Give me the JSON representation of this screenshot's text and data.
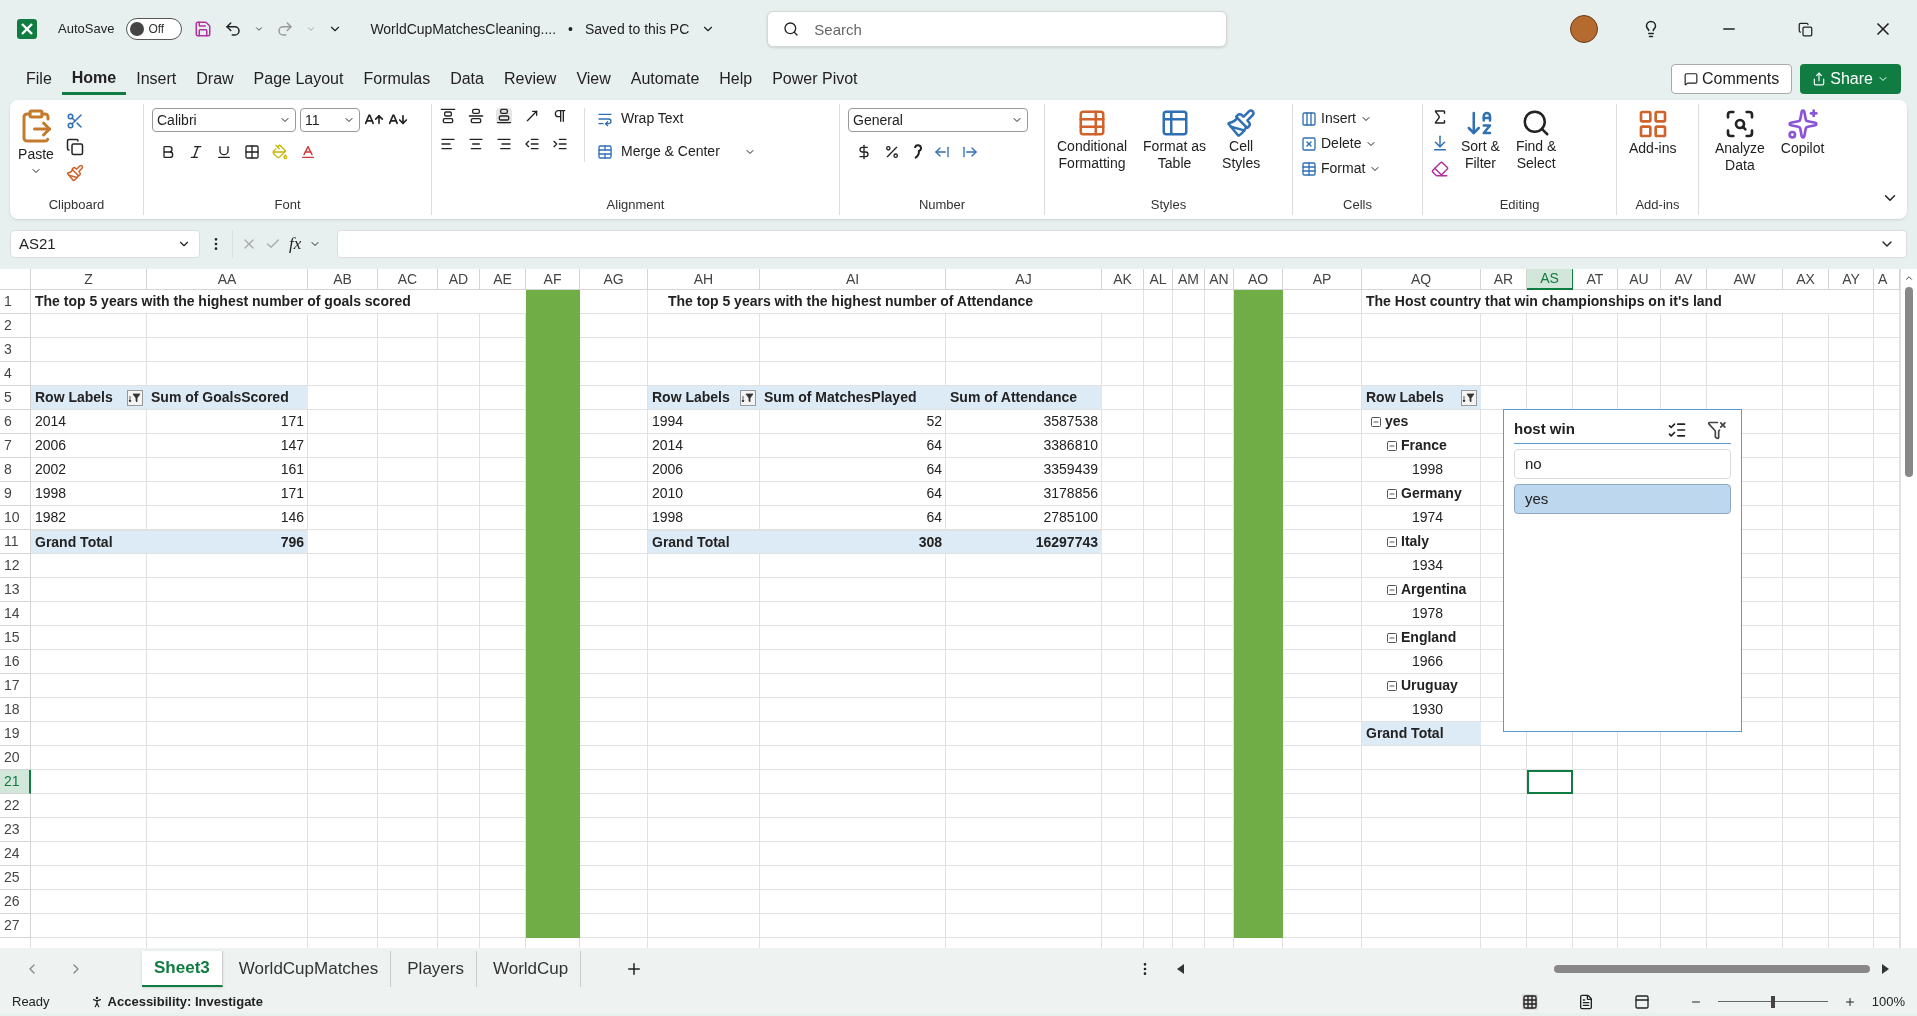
{
  "title_bar": {
    "autosave_label": "AutoSave",
    "autosave": {
      "on": false,
      "label": "Off"
    },
    "file_name": "WorldCupMatchesCleaning....",
    "separator": "•",
    "save_status": "Saved to this PC",
    "search": {
      "placeholder": "Search"
    }
  },
  "menu": {
    "tabs": [
      {
        "label": "File",
        "selected": false
      },
      {
        "label": "Home",
        "selected": true
      },
      {
        "label": "Insert",
        "selected": false
      },
      {
        "label": "Draw",
        "selected": false
      },
      {
        "label": "Page Layout",
        "selected": false
      },
      {
        "label": "Formulas",
        "selected": false
      },
      {
        "label": "Data",
        "selected": false
      },
      {
        "label": "Review",
        "selected": false
      },
      {
        "label": "View",
        "selected": false
      },
      {
        "label": "Automate",
        "selected": false
      },
      {
        "label": "Help",
        "selected": false
      },
      {
        "label": "Power Pivot",
        "selected": false
      }
    ],
    "comments": "Comments",
    "share": "Share"
  },
  "ribbon": {
    "clipboard": {
      "paste": "Paste",
      "label": "Clipboard"
    },
    "font": {
      "name": "Calibri",
      "size": "11",
      "label": "Font"
    },
    "alignment": {
      "wrap": "Wrap Text",
      "merge": "Merge & Center",
      "label": "Alignment"
    },
    "number": {
      "format": "General",
      "label": "Number"
    },
    "styles": {
      "buttons": [
        [
          "Conditional",
          "Formatting"
        ],
        [
          "Format as",
          "Table"
        ],
        [
          "Cell",
          "Styles"
        ]
      ],
      "label": "Styles"
    },
    "cells": {
      "buttons": [
        "Insert",
        "Delete",
        "Format"
      ],
      "label": "Cells"
    },
    "editing": {
      "buttons": [
        [
          "Sort &",
          "Filter"
        ],
        [
          "Find &",
          "Select"
        ]
      ],
      "label": "Editing"
    },
    "addins": {
      "button": "Add-ins",
      "label": "Add-ins"
    },
    "extras": [
      [
        "Analyze",
        "Data"
      ],
      [
        "Copilot"
      ]
    ]
  },
  "formula_bar": {
    "name_box": "AS21",
    "fx": "fx"
  },
  "column_headers": [
    {
      "label": "Z",
      "selected": false
    },
    {
      "label": "AA",
      "selected": false
    },
    {
      "label": "AB",
      "selected": false
    },
    {
      "label": "AC",
      "selected": false
    },
    {
      "label": "AD",
      "selected": false
    },
    {
      "label": "AE",
      "selected": false
    },
    {
      "label": "AF",
      "selected": false
    },
    {
      "label": "AG",
      "selected": false
    },
    {
      "label": "AH",
      "selected": false
    },
    {
      "label": "AI",
      "selected": false
    },
    {
      "label": "AJ",
      "selected": false
    },
    {
      "label": "AK",
      "selected": false
    },
    {
      "label": "AL",
      "selected": false
    },
    {
      "label": "AM",
      "selected": false
    },
    {
      "label": "AN",
      "selected": false
    },
    {
      "label": "AO",
      "selected": false
    },
    {
      "label": "AP",
      "selected": false
    },
    {
      "label": "AQ",
      "selected": false
    },
    {
      "label": "AR",
      "selected": false
    },
    {
      "label": "AS",
      "selected": true
    },
    {
      "label": "AT",
      "selected": false
    },
    {
      "label": "AU",
      "selected": false
    },
    {
      "label": "AV",
      "selected": false
    },
    {
      "label": "AW",
      "selected": false
    },
    {
      "label": "AX",
      "selected": false
    },
    {
      "label": "AY",
      "selected": false
    },
    {
      "label": "A",
      "selected": false
    }
  ],
  "row_headers": [
    {
      "label": "1",
      "selected": false
    },
    {
      "label": "2",
      "selected": false
    },
    {
      "label": "3",
      "selected": false
    },
    {
      "label": "4",
      "selected": false
    },
    {
      "label": "5",
      "selected": false
    },
    {
      "label": "6",
      "selected": false
    },
    {
      "label": "7",
      "selected": false
    },
    {
      "label": "8",
      "selected": false
    },
    {
      "label": "9",
      "selected": false
    },
    {
      "label": "10",
      "selected": false
    },
    {
      "label": "11",
      "selected": false
    },
    {
      "label": "12",
      "selected": false
    },
    {
      "label": "13",
      "selected": false
    },
    {
      "label": "14",
      "selected": false
    },
    {
      "label": "15",
      "selected": false
    },
    {
      "label": "16",
      "selected": false
    },
    {
      "label": "17",
      "selected": false
    },
    {
      "label": "18",
      "selected": false
    },
    {
      "label": "19",
      "selected": false
    },
    {
      "label": "20",
      "selected": false
    },
    {
      "label": "21",
      "selected": true
    },
    {
      "label": "22",
      "selected": false
    },
    {
      "label": "23",
      "selected": false
    },
    {
      "label": "24",
      "selected": false
    },
    {
      "label": "25",
      "selected": false
    },
    {
      "label": "26",
      "selected": false
    },
    {
      "label": "27",
      "selected": false
    }
  ],
  "titles": [
    "The top 5 years with the highest number of goals scored",
    "The top 5 years with the highest number of Attendance",
    "The Host country that win championships on it's land"
  ],
  "pivot_goals": {
    "header": [
      "Row Labels",
      "Sum of GoalsScored"
    ],
    "rows": [
      [
        "2014",
        "171"
      ],
      [
        "2006",
        "147"
      ],
      [
        "2002",
        "161"
      ],
      [
        "1998",
        "171"
      ],
      [
        "1982",
        "146"
      ]
    ],
    "total": [
      "Grand Total",
      "796"
    ]
  },
  "pivot_attendance": {
    "header": [
      "Row Labels",
      "Sum of MatchesPlayed",
      "Sum of Attendance"
    ],
    "rows": [
      [
        "1994",
        "52",
        "3587538"
      ],
      [
        "2014",
        "64",
        "3386810"
      ],
      [
        "2006",
        "64",
        "3359439"
      ],
      [
        "2010",
        "64",
        "3178856"
      ],
      [
        "1998",
        "64",
        "2785100"
      ]
    ],
    "total": [
      "Grand Total",
      "308",
      "16297743"
    ]
  },
  "pivot_host": {
    "header": "Row Labels",
    "items": [
      {
        "label": "yes",
        "expanded": true,
        "children": [
          {
            "label": "France",
            "expanded": true,
            "children": [
              {
                "label": "1998"
              }
            ]
          },
          {
            "label": "Germany",
            "expanded": true,
            "children": [
              {
                "label": "1974"
              }
            ]
          },
          {
            "label": "Italy",
            "expanded": true,
            "children": [
              {
                "label": "1934"
              }
            ]
          },
          {
            "label": "Argentina",
            "expanded": true,
            "children": [
              {
                "label": "1978"
              }
            ]
          },
          {
            "label": "England",
            "expanded": true,
            "children": [
              {
                "label": "1966"
              }
            ]
          },
          {
            "label": "Uruguay",
            "expanded": true,
            "children": [
              {
                "label": "1930"
              }
            ]
          }
        ]
      }
    ],
    "total": "Grand Total"
  },
  "slicer": {
    "title": "host win",
    "items": [
      {
        "label": "no",
        "selected": false
      },
      {
        "label": "yes",
        "selected": true
      }
    ]
  },
  "sheet_tabs": [
    {
      "label": "Sheet3",
      "selected": true
    },
    {
      "label": "WorldCupMatches",
      "selected": false
    },
    {
      "label": "Players",
      "selected": false
    },
    {
      "label": "WorldCup",
      "selected": false
    }
  ],
  "status_bar": {
    "status": "Ready",
    "accessibility": "Accessibility: Investigate",
    "zoom": {
      "level": 0.5,
      "label": "100%"
    }
  }
}
